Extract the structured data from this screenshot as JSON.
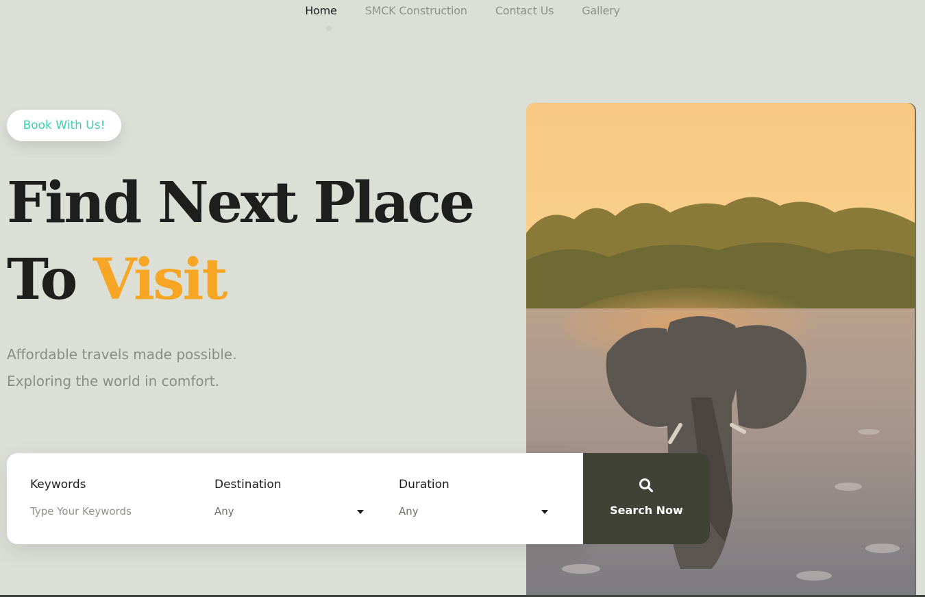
{
  "nav": {
    "items": [
      "Home",
      "SMCK Construction",
      "Contact Us",
      "Gallery"
    ],
    "active": "Home"
  },
  "hero": {
    "badge": "Book With Us!",
    "title_line1": "Find Next Place",
    "title_line2_prefix": "To",
    "title_line2_accent": "Visit",
    "subtitle_line1": "Affordable travels made possible.",
    "subtitle_line2": "Exploring the world in comfort."
  },
  "search": {
    "keywords_label": "Keywords",
    "keywords_placeholder": "Type Your Keywords",
    "destination_label": "Destination",
    "destination_value": "Any",
    "duration_label": "Duration",
    "duration_value": "Any",
    "button_label": "Search Now",
    "button_icon": "search-icon"
  },
  "colors": {
    "background": "#dcdfd6",
    "accent": "#f6a624",
    "badge_text": "#3ecfb0",
    "button_bg": "#3f4234"
  }
}
